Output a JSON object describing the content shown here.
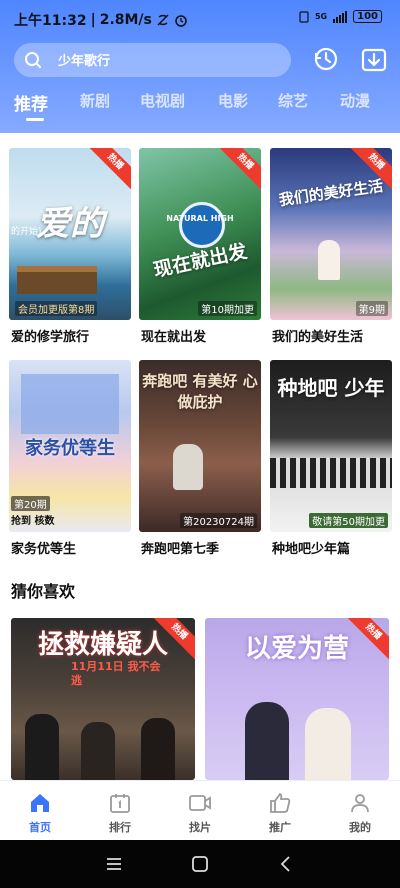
{
  "status": {
    "time": "上午11:32",
    "speed": "2.8M/s",
    "network": "5G",
    "battery": "100"
  },
  "search": {
    "placeholder": "少年歌行"
  },
  "tabs": [
    {
      "label": "推荐",
      "active": true
    },
    {
      "label": "新剧"
    },
    {
      "label": "电视剧"
    },
    {
      "label": "电影"
    },
    {
      "label": "综艺"
    },
    {
      "label": "动漫"
    }
  ],
  "grid": [
    {
      "name": "爱的修学旅行",
      "badge": "热播",
      "episode": "会员加更版第8期",
      "poster_text": "爱的",
      "poster_sub": "的开始)"
    },
    {
      "name": "现在就出发",
      "badge": "热播",
      "episode": "第10期加更",
      "poster_text": "现在就出发",
      "poster_sub": "NATURAL HIGH"
    },
    {
      "name": "我们的美好生活",
      "badge": "热播",
      "episode": "第9期",
      "poster_text": "我们的美好生活"
    },
    {
      "name": "家务优等生",
      "badge": "",
      "episode": "第20期",
      "poster_text": "家务优等生",
      "poster_sub": "抢到 核数"
    },
    {
      "name": "奔跑吧第七季",
      "badge": "",
      "episode": "第20230724期",
      "poster_text": "奔跑吧 有美好 心做庇护"
    },
    {
      "name": "种地吧少年篇",
      "badge": "",
      "episode": "敬请第50期加更",
      "poster_text": "种地吧 少年"
    }
  ],
  "section": {
    "title": "猜你喜欢"
  },
  "recommend": [
    {
      "name": "拯救嫌疑人",
      "badge": "热播",
      "poster_text": "拯救嫌疑人",
      "poster_sub": "11月11日 我不会逃"
    },
    {
      "name": "以爱为营",
      "badge": "热播",
      "poster_text": "以爱为营"
    }
  ],
  "nav": [
    {
      "label": "首页",
      "active": true
    },
    {
      "label": "排行"
    },
    {
      "label": "找片"
    },
    {
      "label": "推广"
    },
    {
      "label": "我的"
    }
  ],
  "colors": {
    "accent": "#3b74ff",
    "badge": "#ef3b2d",
    "header_top": "#4f86ff"
  }
}
